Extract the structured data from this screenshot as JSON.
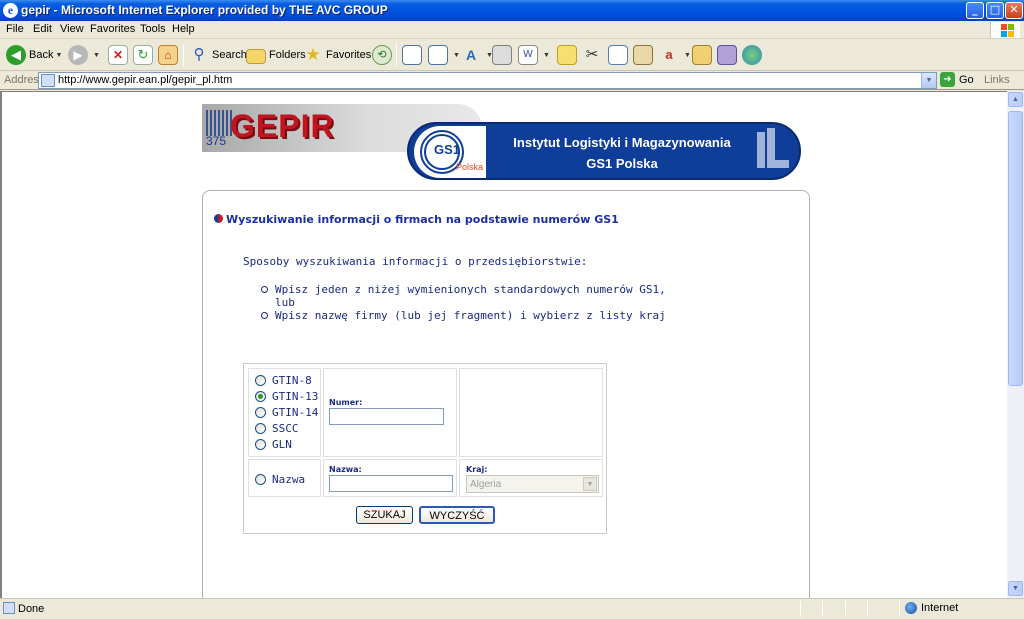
{
  "window": {
    "title": "gepir - Microsoft Internet Explorer provided by THE AVC GROUP",
    "min_glyph": "_",
    "max_glyph": "□",
    "close_glyph": "✕"
  },
  "menu": [
    "File",
    "Edit",
    "View",
    "Favorites",
    "Tools",
    "Help"
  ],
  "toolbar": {
    "back": "Back",
    "search": "Search",
    "folders": "Folders",
    "favorites": "Favorites"
  },
  "address": {
    "label": "Address",
    "url": "http://www.gepir.ean.pl/gepir_pl.htm",
    "go": "Go",
    "links": "Links"
  },
  "banner": {
    "gepir": "GEPIR",
    "barcode_digits": "375",
    "gs1": "GS1",
    "gs1_country": "Polska",
    "institute_line1": "Instytut Logistyki i Magazynowania",
    "institute_line2": "GS1 Polska"
  },
  "content": {
    "heading": "Wyszukiwanie informacji o firmach na podstawie numerów GS1",
    "intro": "Sposoby wyszukiwania informacji o przedsiębiorstwie:",
    "bullets": [
      "Wpisz jeden z niżej wymienionych standardowych numerów GS1,",
      "lub",
      "Wpisz nazwę firmy (lub jej fragment) i wybierz z listy kraj"
    ]
  },
  "form": {
    "radios": [
      {
        "label": "GTIN-8",
        "checked": false
      },
      {
        "label": "GTIN-13",
        "checked": true
      },
      {
        "label": "GTIN-14",
        "checked": false
      },
      {
        "label": "SSCC",
        "checked": false
      },
      {
        "label": "GLN",
        "checked": false
      }
    ],
    "numer_label": "Numer:",
    "numer_value": "",
    "nazwa_radio": "Nazwa",
    "nazwa_label": "Nazwa:",
    "nazwa_value": "",
    "kraj_label": "Kraj:",
    "kraj_selected": "Algeria",
    "search_button": "SZUKAJ",
    "clear_button": "WYCZYŚĆ"
  },
  "status": {
    "text": "Done",
    "zone": "Internet"
  }
}
